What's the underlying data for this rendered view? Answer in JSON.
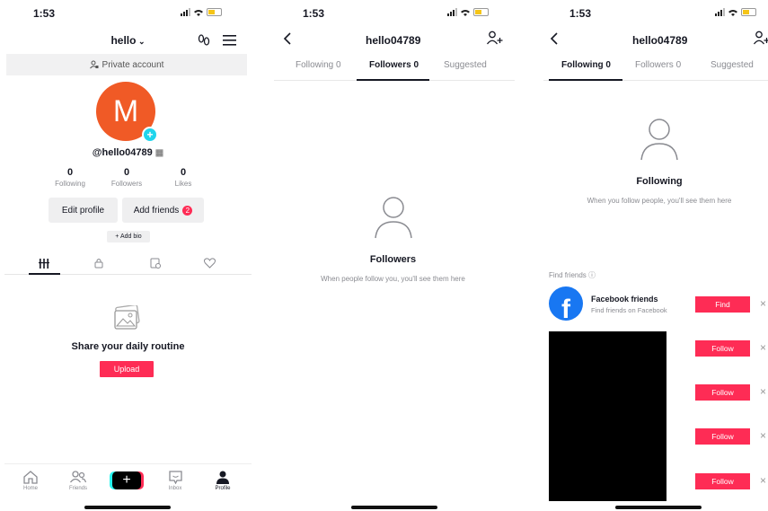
{
  "status": {
    "time": "1:53"
  },
  "profile_screen": {
    "title": "hello",
    "private_account": "Private account",
    "avatar_letter": "M",
    "avatar_plus": "+",
    "username": "@hello04789",
    "stats": [
      {
        "value": "0",
        "label": "Following"
      },
      {
        "value": "0",
        "label": "Followers"
      },
      {
        "value": "0",
        "label": "Likes"
      }
    ],
    "edit_profile": "Edit profile",
    "add_friends": "Add friends",
    "add_friends_badge": "2",
    "add_bio": "+ Add bio",
    "empty_title": "Share your daily routine",
    "upload": "Upload",
    "nav": [
      {
        "label": "Home",
        "icon": "home-icon"
      },
      {
        "label": "Friends",
        "icon": "friends-icon"
      },
      {
        "label": "",
        "icon": "create-icon"
      },
      {
        "label": "Inbox",
        "icon": "inbox-icon"
      },
      {
        "label": "Profile",
        "icon": "profile-icon"
      }
    ],
    "create_symbol": "+"
  },
  "followers_screen": {
    "title": "hello04789",
    "tabs": [
      "Following 0",
      "Followers 0",
      "Suggested"
    ],
    "active_tab": 1,
    "empty_title": "Followers",
    "empty_sub": "When people follow you, you'll see them here"
  },
  "following_screen": {
    "title": "hello04789",
    "tabs": [
      "Following 0",
      "Followers 0",
      "Suggested"
    ],
    "active_tab": 0,
    "empty_title": "Following",
    "empty_sub": "When you follow people, you'll see them here",
    "find_friends_label": "Find friends",
    "facebook": {
      "title": "Facebook friends",
      "sub": "Find friends on Facebook",
      "button": "Find"
    },
    "follow_buttons": [
      "Follow",
      "Follow",
      "Follow",
      "Follow"
    ],
    "dismiss": "×"
  },
  "colors": {
    "accent": "#fe2c55",
    "avatar": "#f05a26",
    "plus": "#20d5ec",
    "facebook": "#1877f2"
  }
}
